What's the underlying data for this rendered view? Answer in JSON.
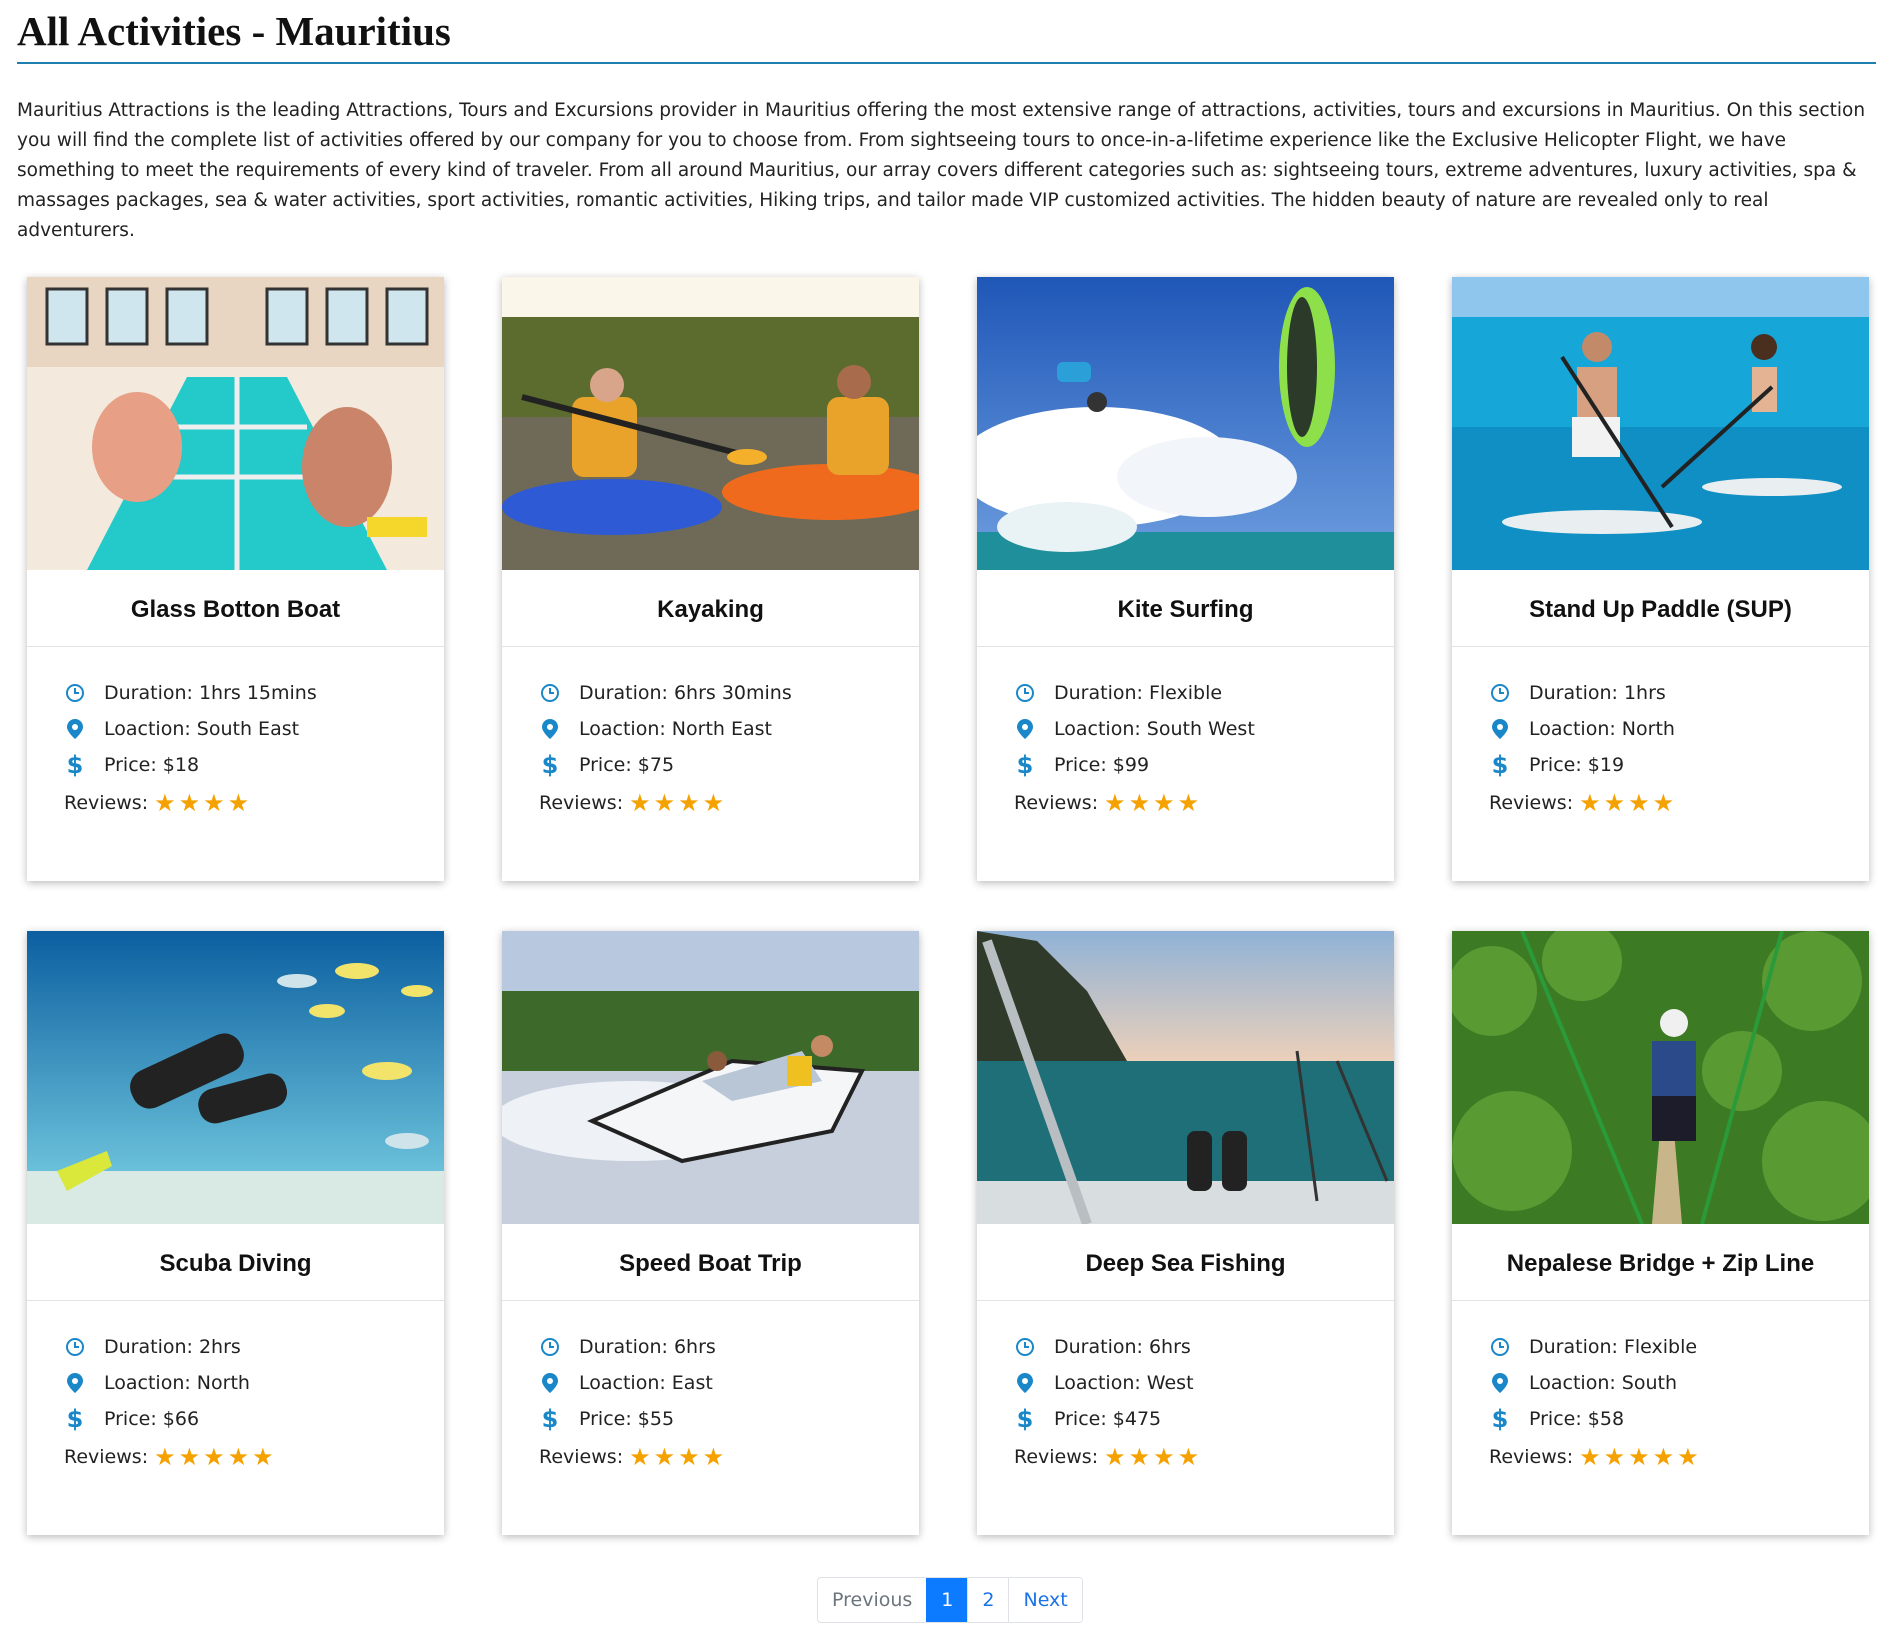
{
  "page": {
    "title": "All Activities - Mauritius",
    "intro": "Mauritius Attractions is the leading Attractions, Tours and Excursions provider in Mauritius offering the most extensive range of attractions, activities, tours and excursions in Mauritius. On this section you will find the complete list of activities offered by our company for you to choose from. From sightseeing tours to once-in-a-lifetime experience like the Exclusive Helicopter Flight, we have something to meet the requirements of every kind of traveler. From all around Mauritius, our array covers different categories such as: sightseeing tours, extreme adventures, luxury activities, spa & massages packages, sea & water activities, sport activities, romantic activities, Hiking trips, and tailor made VIP customized activities. The hidden beauty of nature are revealed only to real adventurers."
  },
  "colors": {
    "accent": "#1a87c8",
    "star": "#f5a100",
    "active_page": "#0d7bff",
    "rule": "#1f7fae"
  },
  "cards": [
    {
      "title": "Glass Botton Boat",
      "duration": "Duration: 1hrs 15mins",
      "location": "Loaction: South East",
      "price": "Price: $18",
      "reviews_label": "Reviews:",
      "stars": "★★★★",
      "rating": 4,
      "image": "glass-bottom-boat-photo"
    },
    {
      "title": "Kayaking",
      "duration": "Duration: 6hrs 30mins",
      "location": "Loaction: North East",
      "price": "Price: $75",
      "reviews_label": "Reviews:",
      "stars": "★★★★",
      "rating": 4,
      "image": "kayaking-photo"
    },
    {
      "title": "Kite Surfing",
      "duration": "Duration: Flexible",
      "location": "Loaction: South West",
      "price": "Price: $99",
      "reviews_label": "Reviews:",
      "stars": "★★★★",
      "rating": 4,
      "image": "kite-surfing-photo"
    },
    {
      "title": "Stand Up Paddle (SUP)",
      "duration": "Duration: 1hrs",
      "location": "Loaction: North",
      "price": "Price: $19",
      "reviews_label": "Reviews:",
      "stars": "★★★★",
      "rating": 4,
      "image": "stand-up-paddle-photo"
    },
    {
      "title": "Scuba Diving",
      "duration": "Duration: 2hrs",
      "location": "Loaction: North",
      "price": "Price: $66",
      "reviews_label": "Reviews:",
      "stars": "★★★★★",
      "rating": 5,
      "image": "scuba-diving-photo"
    },
    {
      "title": "Speed Boat Trip",
      "duration": "Duration: 6hrs",
      "location": "Loaction: East",
      "price": "Price: $55",
      "reviews_label": "Reviews:",
      "stars": "★★★★",
      "rating": 4,
      "image": "speed-boat-photo"
    },
    {
      "title": "Deep Sea Fishing",
      "duration": "Duration: 6hrs",
      "location": "Loaction: West",
      "price": "Price: $475",
      "reviews_label": "Reviews:",
      "stars": "★★★★",
      "rating": 4,
      "image": "deep-sea-fishing-photo"
    },
    {
      "title": "Nepalese Bridge + Zip Line",
      "duration": "Duration: Flexible",
      "location": "Loaction: South",
      "price": "Price: $58",
      "reviews_label": "Reviews:",
      "stars": "★★★★★",
      "rating": 5,
      "image": "zip-line-photo"
    }
  ],
  "pagination": {
    "previous": "Previous",
    "pages": [
      "1",
      "2"
    ],
    "current": "1",
    "next": "Next"
  }
}
